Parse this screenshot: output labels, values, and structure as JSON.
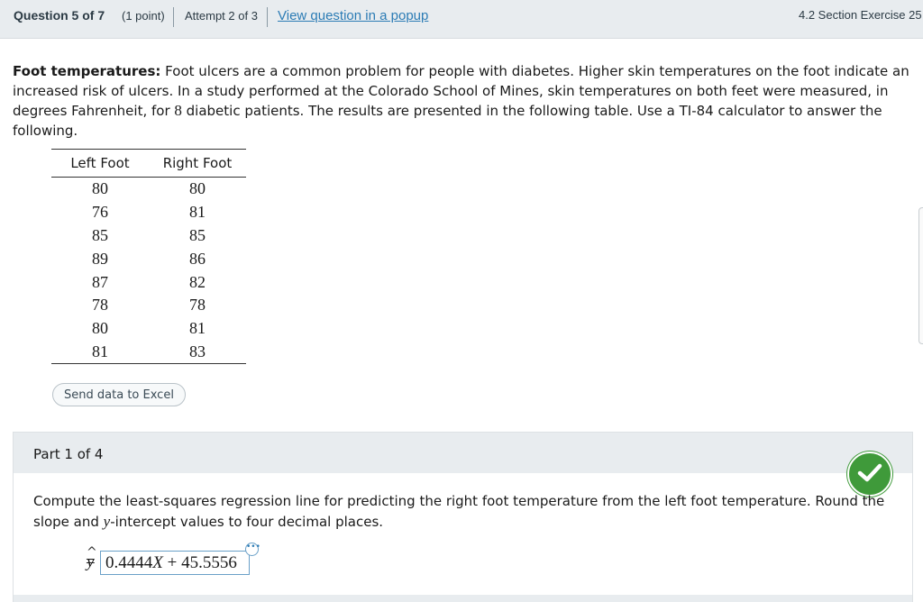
{
  "header": {
    "question_label": "Question 5 of 7",
    "points": "(1 point)",
    "attempt": "Attempt 2 of 3",
    "popup_link": "View question in a popup",
    "section": "4.2 Section Exercise 25"
  },
  "question": {
    "title": "Foot temperatures:",
    "text_before_n": " Foot ulcers are a common problem for people with diabetes. Higher skin temperatures on the foot indicate an increased risk of ulcers. In a study performed at the Colorado School of Mines, skin temperatures on both feet were measured, in degrees Fahrenheit, for ",
    "n": "8",
    "text_after_n": " diabetic patients. The results are presented in the following table. Use a TI-84 calculator to answer the following."
  },
  "table": {
    "headers": [
      "Left Foot",
      "Right Foot"
    ],
    "rows": [
      [
        "80",
        "80"
      ],
      [
        "76",
        "81"
      ],
      [
        "85",
        "85"
      ],
      [
        "89",
        "86"
      ],
      [
        "87",
        "82"
      ],
      [
        "78",
        "78"
      ],
      [
        "80",
        "81"
      ],
      [
        "81",
        "83"
      ]
    ]
  },
  "excel_button": "Send data to Excel",
  "part": {
    "title": "Part 1 of 4",
    "prompt_before": "Compute the least-squares regression line for predicting the right foot temperature from the left foot temperature. Round the slope and ",
    "prompt_var": "y",
    "prompt_after": "-intercept values to four decimal places.",
    "yhat": "y",
    "equals": "=",
    "answer_slope": "0.4444",
    "answer_var": "X",
    "answer_rest": " + 45.5556",
    "more_glyph": "•••"
  },
  "colors": {
    "header_bg": "#e8ecef",
    "link": "#2c7cb5",
    "correct_green": "#3f9a3a"
  },
  "icons": {
    "correct": "checkmark-icon",
    "more": "more-options-icon"
  }
}
